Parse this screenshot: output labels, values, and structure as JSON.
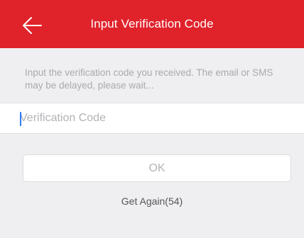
{
  "header": {
    "title": "Input Verification Code",
    "back_icon": "arrow-left-icon"
  },
  "instructions": "Input the verification code you received. The email or SMS may be delayed, please wait...",
  "code_input": {
    "placeholder": "Verification Code",
    "value": ""
  },
  "ok_button": {
    "label": "OK"
  },
  "resend": {
    "label": "Get Again(54)"
  },
  "colors": {
    "header_background": "#e0222b",
    "page_background": "#efeff1",
    "caret": "#2f7df6"
  }
}
